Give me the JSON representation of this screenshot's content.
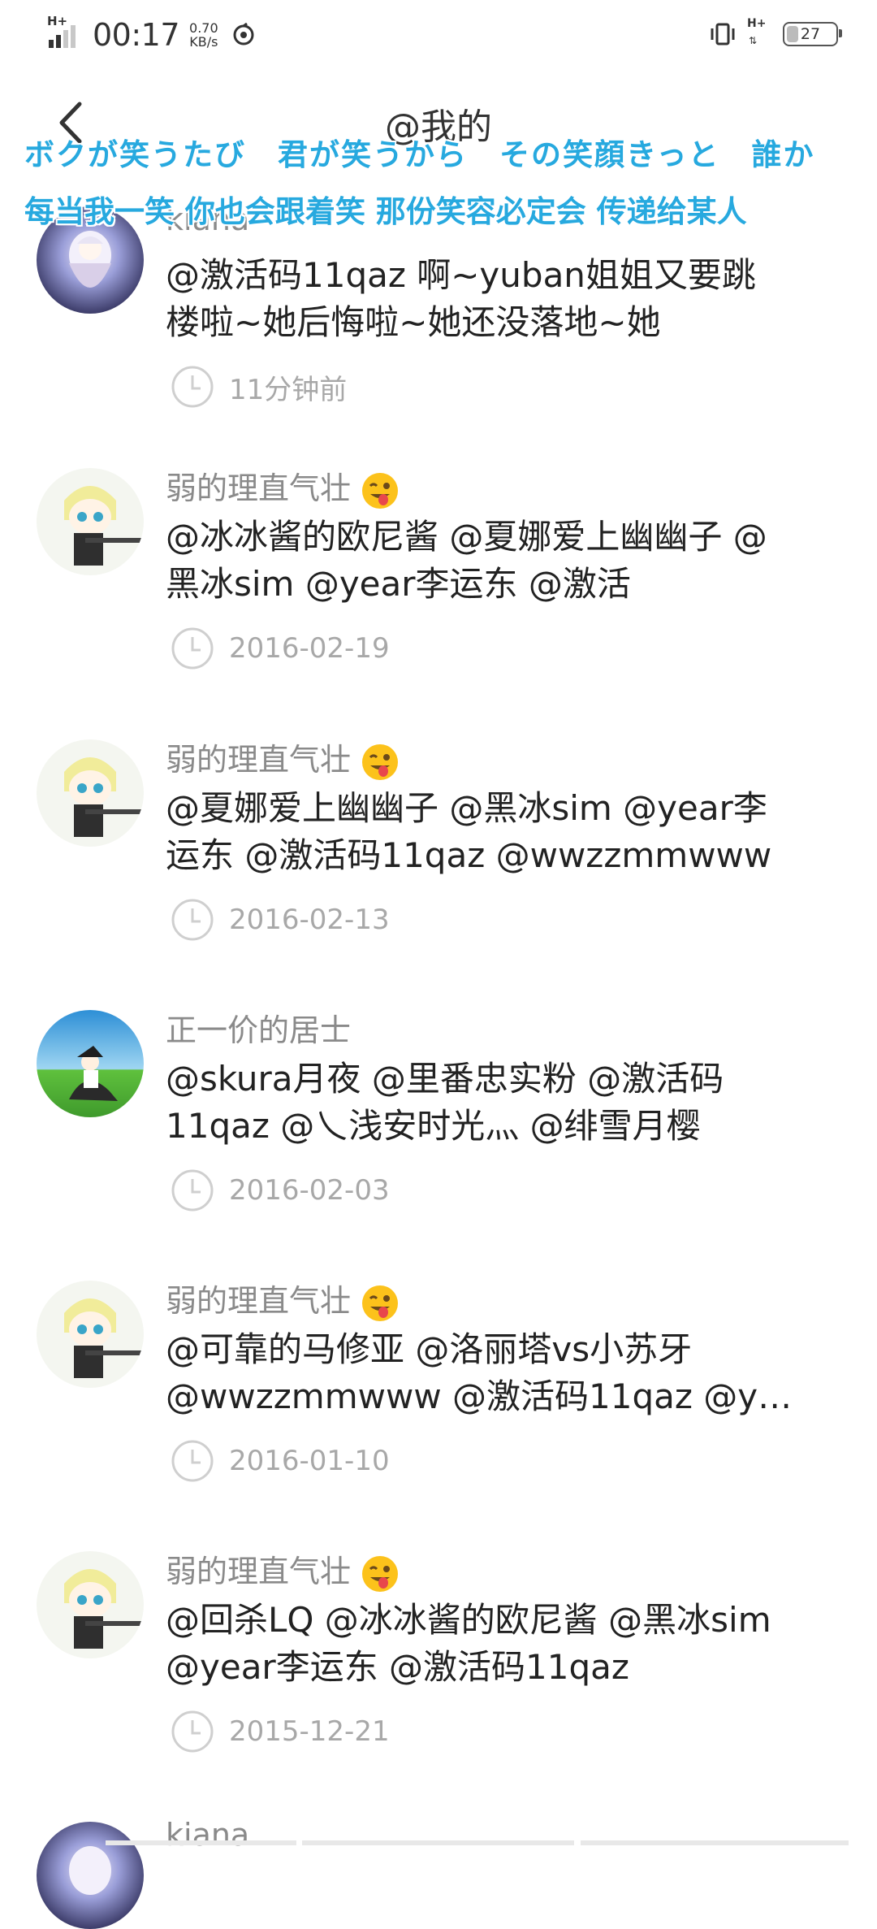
{
  "status_bar": {
    "network_left": "H+",
    "time": "00:17",
    "speed_value": "0.70",
    "speed_unit": "KB/s",
    "network_right": "H+",
    "battery": "27"
  },
  "header": {
    "title": "@我的"
  },
  "lyrics": {
    "japanese": "ボクが笑うたび　君が笑うから　その笑顔きっと　誰か",
    "chinese": "每当我一笑  你也会跟着笑  那份笑容必定会  传递给某人"
  },
  "items": [
    {
      "user": "kiana",
      "lines": [
        "@激活码11qaz 啊~yuban姐姐又要跳",
        "楼啦~她后悔啦~她还没落地~她"
      ],
      "time": "11分钟前",
      "avatar": "kiana-avatar"
    },
    {
      "user": "弱的理直气壮",
      "emoji": true,
      "lines": [
        "@冰冰酱的欧尼酱 @夏娜爱上幽幽子 @",
        "黑冰sim @year李运东 @激活"
      ],
      "time": "2016-02-19",
      "avatar": "blonde-gunner-avatar"
    },
    {
      "user": "弱的理直气壮",
      "emoji": true,
      "lines": [
        "@夏娜爱上幽幽子 @黑冰sim @year李",
        "运东 @激活码11qaz @wwzzmmwww"
      ],
      "time": "2016-02-13",
      "avatar": "blonde-gunner-avatar"
    },
    {
      "user": "正一价的居士",
      "lines": [
        "@skura月夜 @里番忠实粉 @激活码",
        "11qaz @乀浅安时光灬 @绯雪月樱"
      ],
      "time": "2016-02-03",
      "avatar": "field-girl-avatar"
    },
    {
      "user": "弱的理直气壮",
      "emoji": true,
      "lines": [
        "@可靠的马修亚 @洛丽塔vs小苏牙",
        "@wwzzmmwww @激活码11qaz @y…"
      ],
      "time": "2016-01-10",
      "avatar": "blonde-gunner-avatar"
    },
    {
      "user": "弱的理直气壮",
      "emoji": true,
      "lines": [
        "@回杀LQ @冰冰酱的欧尼酱 @黑冰sim",
        "@year李运东 @激活码11qaz"
      ],
      "time": "2015-12-21",
      "avatar": "blonde-gunner-avatar"
    },
    {
      "user": "kiana",
      "lines": [],
      "time": "",
      "avatar": "kiana-avatar"
    }
  ],
  "colors": {
    "lyric": "#27a9df",
    "username": "#8a8a8a",
    "time": "#a8a8a8"
  }
}
